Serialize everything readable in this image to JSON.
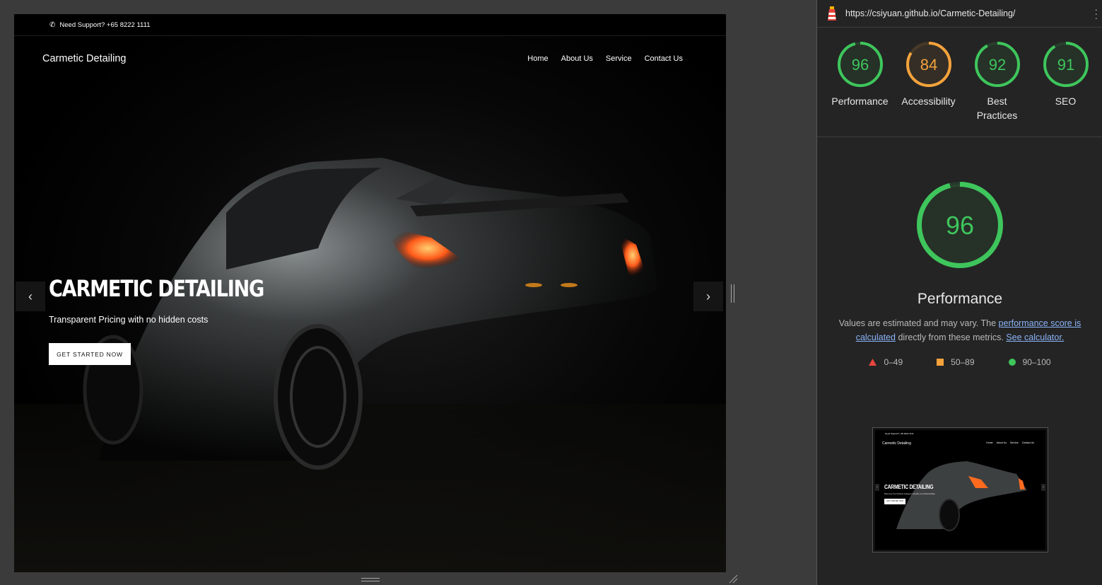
{
  "site": {
    "support_text": "Need Support? +65 8222 1111",
    "brand": "Carmetic Detailing",
    "nav": [
      "Home",
      "About Us",
      "Service",
      "Contact Us"
    ],
    "hero_title": "CARMETIC DETAILING",
    "hero_subtitle": "Transparent Pricing with no hidden costs",
    "cta_label": "GET STARTED NOW"
  },
  "panel": {
    "url": "https://csiyuan.github.io/Carmetic-Detailing/",
    "gauges": [
      {
        "label": "Performance",
        "score": 96,
        "color": "#3ec65c"
      },
      {
        "label": "Accessibility",
        "score": 84,
        "color": "#f4a33c"
      },
      {
        "label": "Best Practices",
        "score": 92,
        "color": "#3ec65c"
      },
      {
        "label": "SEO",
        "score": 91,
        "color": "#3ec65c"
      }
    ],
    "main_score": 96,
    "main_label": "Performance",
    "desc_prefix": "Values are estimated and may vary. The ",
    "desc_link1": "performance score is calculated",
    "desc_mid": " directly from these metrics. ",
    "desc_link2": "See calculator.",
    "legend": [
      {
        "range": "0–49",
        "shape": "triangle",
        "color": "#e8453c"
      },
      {
        "range": "50–89",
        "shape": "square",
        "color": "#f4a33c"
      },
      {
        "range": "90–100",
        "shape": "circle",
        "color": "#3ec65c"
      }
    ],
    "thumb": {
      "support_text": "Need Support? +65 8222 1111",
      "brand": "Carmetic Detailing",
      "nav": [
        "Home",
        "About Us",
        "Service",
        "Contact Us"
      ],
      "hero_title": "CARMETIC DETAILING",
      "hero_subtitle": "Discover the Distinct between Quality and Affordability",
      "cta_label": "GET STARTED NOW"
    }
  }
}
